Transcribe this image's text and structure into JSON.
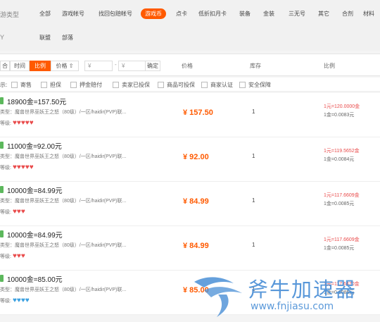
{
  "topnav": {
    "side_label_1": "游类型",
    "side_label_2": "Y",
    "categories_row1": [
      "全部",
      "游戏帐号",
      "找回包赔帐号",
      "游戏币",
      "点卡",
      "低折扣月卡",
      "装备",
      "金装",
      "三无号",
      "其它",
      "合剂",
      "材料"
    ],
    "active_index": 3,
    "categories_row2": [
      "联盟",
      "部落"
    ]
  },
  "filterbar": {
    "sort_default": "合",
    "sort_time": "时间",
    "sort_ratio": "比例",
    "sort_price": "价格 ⇧",
    "price_min_placeholder": "¥",
    "price_max_placeholder": "¥",
    "range_dash": "-",
    "confirm": "确定",
    "col_price": "价格",
    "col_stock": "库存",
    "col_ratio": "比例"
  },
  "options": {
    "label": "示:",
    "items": [
      "寄售",
      "担保",
      "押金赔付",
      "卖家已投保",
      "商品可投保",
      "商家认证",
      "安全保障"
    ]
  },
  "listings": [
    {
      "title": "18900金=157.50元",
      "desc": "类型：魔兽世界巫妖王之怒（80级）/一区/haidir(PVP)联...",
      "level_label": "等级:",
      "hearts": "♥♥♥♥♥",
      "heart_color": "red",
      "price": "¥ 157.50",
      "stock": "1",
      "ratio1": "1元=120.0000金",
      "ratio2": "1金=0.0083元"
    },
    {
      "title": "11000金=92.00元",
      "desc": "类型：魔兽世界巫妖王之怒（80级）/一区/haidir(PVP)联...",
      "level_label": "等级:",
      "hearts": "♥♥♥♥♥",
      "heart_color": "red",
      "price": "¥ 92.00",
      "stock": "1",
      "ratio1": "1元=119.5652金",
      "ratio2": "1金=0.0084元"
    },
    {
      "title": "10000金=84.99元",
      "desc": "类型：魔兽世界巫妖王之怒（80级）/一区/haidir(PVP)联...",
      "level_label": "等级:",
      "hearts": "♥♥♥",
      "heart_color": "red",
      "price": "¥ 84.99",
      "stock": "1",
      "ratio1": "1元=117.6609金",
      "ratio2": "1金=0.0085元"
    },
    {
      "title": "10000金=84.99元",
      "desc": "类型：魔兽世界巫妖王之怒（80级）/一区/haidir(PVP)联...",
      "level_label": "等级:",
      "hearts": "♥♥♥",
      "heart_color": "red",
      "price": "¥ 84.99",
      "stock": "1",
      "ratio1": "1元=117.6609金",
      "ratio2": "1金=0.0085元"
    },
    {
      "title": "10000金=85.00元",
      "desc": "类型：魔兽世界巫妖王之怒（80级）/一区/haidir(PVP)联...",
      "level_label": "等级:",
      "hearts": "♥♥♥♥",
      "heart_color": "blue",
      "price": "¥ 85.00",
      "stock": "1",
      "ratio1": "1元=117.6470金",
      "ratio2": "1金=0.0085元"
    }
  ],
  "watermark": {
    "brand": "斧牛加速器",
    "url": "www.fnjiasu.com",
    "color": "#4a8fd6"
  },
  "colors": {
    "accent": "#ff5a00",
    "heart_red": "#e94b4b",
    "heart_blue": "#3aa0e0"
  }
}
